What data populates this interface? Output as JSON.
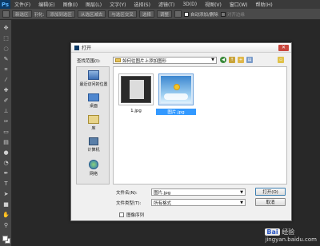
{
  "app": {
    "logo": "Ps",
    "menu": [
      "文件(F)",
      "编辑(E)",
      "图像(I)",
      "图层(L)",
      "文字(Y)",
      "选择(S)",
      "滤镜(T)",
      "3D(D)",
      "视图(V)",
      "窗口(W)",
      "帮助(H)"
    ]
  },
  "options": {
    "mode": "新选区",
    "feather": "羽化:",
    "b1": "添加到选区",
    "b2": "从选区减去",
    "b3": "与选区交叉",
    "b4": "选择",
    "b5": "调整",
    "auto_add": "自动添加/删除",
    "align": "对齐边缘"
  },
  "dialog": {
    "title": "打开",
    "close": "✕",
    "look_in_label": "查找范围(I):",
    "look_in_value": "如何往图片上添加图形",
    "places": [
      {
        "label": "最近访问的位置",
        "icon": "recent-places-icon"
      },
      {
        "label": "桌面",
        "icon": "desktop-icon"
      },
      {
        "label": "库",
        "icon": "library-icon"
      },
      {
        "label": "计算机",
        "icon": "computer-icon"
      },
      {
        "label": "网络",
        "icon": "network-icon"
      }
    ],
    "files": [
      {
        "name": "1.jpg",
        "selected": false
      },
      {
        "name": "图片.jpg",
        "selected": true
      }
    ],
    "filename_label": "文件名(N):",
    "filename_value": "图片.jpg",
    "filetype_label": "文件类型(T):",
    "filetype_value": "所有格式",
    "open_button": "打开(O)",
    "cancel_button": "取消",
    "sequence_label": "图像序列"
  },
  "watermark": {
    "brand": "Bai",
    "text": "经验",
    "url": "jingyan.baidu.com"
  }
}
